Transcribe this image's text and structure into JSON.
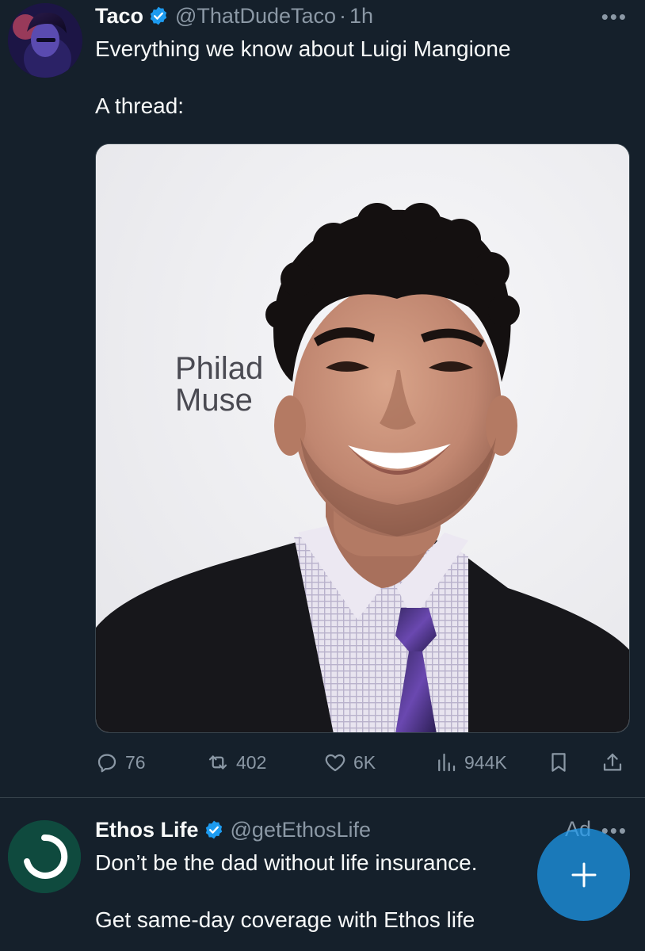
{
  "tweet": {
    "author": {
      "display_name": "Taco",
      "handle": "@ThatDudeTaco",
      "separator": "·",
      "time": "1h",
      "verified": true
    },
    "text_line1": "Everything we know about Luigi Mangione",
    "text_line2": "A thread:",
    "media": {
      "sign_line1": "Philad",
      "sign_line2": "Muse"
    },
    "actions": {
      "replies": "76",
      "reposts": "402",
      "likes": "6K",
      "views": "944K"
    },
    "more_icon": "ellipsis-icon"
  },
  "ad_tweet": {
    "author": {
      "display_name": "Ethos Life",
      "handle": "@getEthosLife",
      "verified": true
    },
    "ad_label": "Ad",
    "text_line1": "Don’t be the dad without life insurance.",
    "text_line2": "Get same-day coverage with Ethos life"
  },
  "fab": {
    "icon": "plus-icon",
    "color": "#1d9bf0"
  },
  "colors": {
    "background": "#15202b",
    "text_primary": "#f7f9f9",
    "text_secondary": "#8b98a5",
    "accent": "#1d9bf0",
    "divider": "#38444d"
  }
}
